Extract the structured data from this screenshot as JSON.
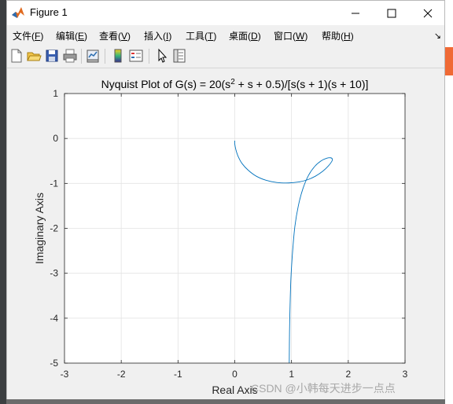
{
  "window": {
    "title": "Figure 1"
  },
  "menubar": {
    "items": [
      {
        "label": "文件",
        "key": "F"
      },
      {
        "label": "编辑",
        "key": "E"
      },
      {
        "label": "查看",
        "key": "V"
      },
      {
        "label": "插入",
        "key": "I"
      },
      {
        "label": "工具",
        "key": "T"
      },
      {
        "label": "桌面",
        "key": "D"
      },
      {
        "label": "窗口",
        "key": "W"
      },
      {
        "label": "帮助",
        "key": "H"
      }
    ]
  },
  "toolbar": {
    "icons": [
      "new-figure-icon",
      "open-file-icon",
      "save-icon",
      "print-icon",
      "link-plot-icon",
      "colorbar-icon",
      "legend-icon",
      "edit-plot-icon",
      "property-inspector-icon"
    ]
  },
  "chart_data": {
    "type": "line",
    "title": "Nyquist Plot of G(s) = 20(s² + s + 0.5)/[s(s + 1)(s + 10)]",
    "title_parts": {
      "before_sup": "Nyquist Plot of G(s) = 20(s",
      "sup": "2",
      "after_sup": " + s + 0.5)/[s(s + 1)(s + 10)]"
    },
    "xlabel": "Real Axis",
    "ylabel": "Imaginary Axis",
    "xlim": [
      -3,
      3
    ],
    "ylim": [
      -5,
      1
    ],
    "xticks": [
      -3,
      -2,
      -1,
      0,
      1,
      2,
      3
    ],
    "yticks": [
      1,
      0,
      -1,
      -2,
      -3,
      -4,
      -5
    ],
    "grid": true,
    "line_color": "#0072bd",
    "series": [
      {
        "points": [
          [
            0.0,
            -0.05
          ],
          [
            0.0,
            -0.12
          ],
          [
            0.02,
            -0.25
          ],
          [
            0.06,
            -0.4
          ],
          [
            0.13,
            -0.56
          ],
          [
            0.24,
            -0.71
          ],
          [
            0.38,
            -0.84
          ],
          [
            0.55,
            -0.93
          ],
          [
            0.74,
            -0.98
          ],
          [
            0.95,
            -0.99
          ],
          [
            1.12,
            -0.97
          ],
          [
            1.28,
            -0.92
          ],
          [
            1.42,
            -0.84
          ],
          [
            1.55,
            -0.73
          ],
          [
            1.65,
            -0.61
          ],
          [
            1.71,
            -0.51
          ],
          [
            1.72,
            -0.46
          ],
          [
            1.69,
            -0.43
          ],
          [
            1.62,
            -0.44
          ],
          [
            1.52,
            -0.5
          ],
          [
            1.41,
            -0.62
          ],
          [
            1.3,
            -0.82
          ],
          [
            1.2,
            -1.12
          ],
          [
            1.12,
            -1.5
          ],
          [
            1.06,
            -1.95
          ],
          [
            1.02,
            -2.5
          ],
          [
            0.99,
            -3.1
          ],
          [
            0.975,
            -3.7
          ],
          [
            0.965,
            -4.3
          ],
          [
            0.96,
            -5.0
          ]
        ]
      }
    ]
  },
  "watermark": "CSDN @小韩每天进步一点点"
}
